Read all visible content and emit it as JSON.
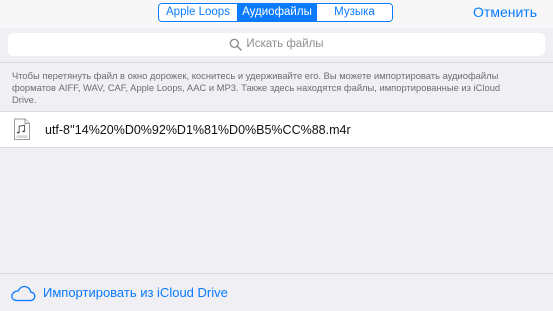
{
  "segmented_control": {
    "options": [
      "Apple Loops",
      "Аудиофайлы",
      "Музыка"
    ],
    "selected": "Аудиофайлы"
  },
  "header": {
    "done_label": "Отменить"
  },
  "search": {
    "placeholder": "Искать файлы"
  },
  "hint": {
    "text": "Чтобы перетянуть файл в окно дорожек, коснитесь и удерживайте его. Вы можете импортировать аудиофайлы форматов AIFF, WAV, CAF, Apple Loops, AAC и MP3. Также здесь находятся файлы, импортированные из iCloud Drive."
  },
  "files": [
    {
      "name": "utf-8''14%20%D0%92%D1%81%D0%B5%CC%88.m4r",
      "icon": "audio-file-icon"
    }
  ],
  "bottom": {
    "icloud_label": "Импортировать из iCloud Drive",
    "icon": "cloud-icon"
  },
  "colors": {
    "accent": "#0a7bff",
    "background": "#efeff4",
    "row_background": "#ffffff",
    "hint_text": "#6d6d72"
  }
}
